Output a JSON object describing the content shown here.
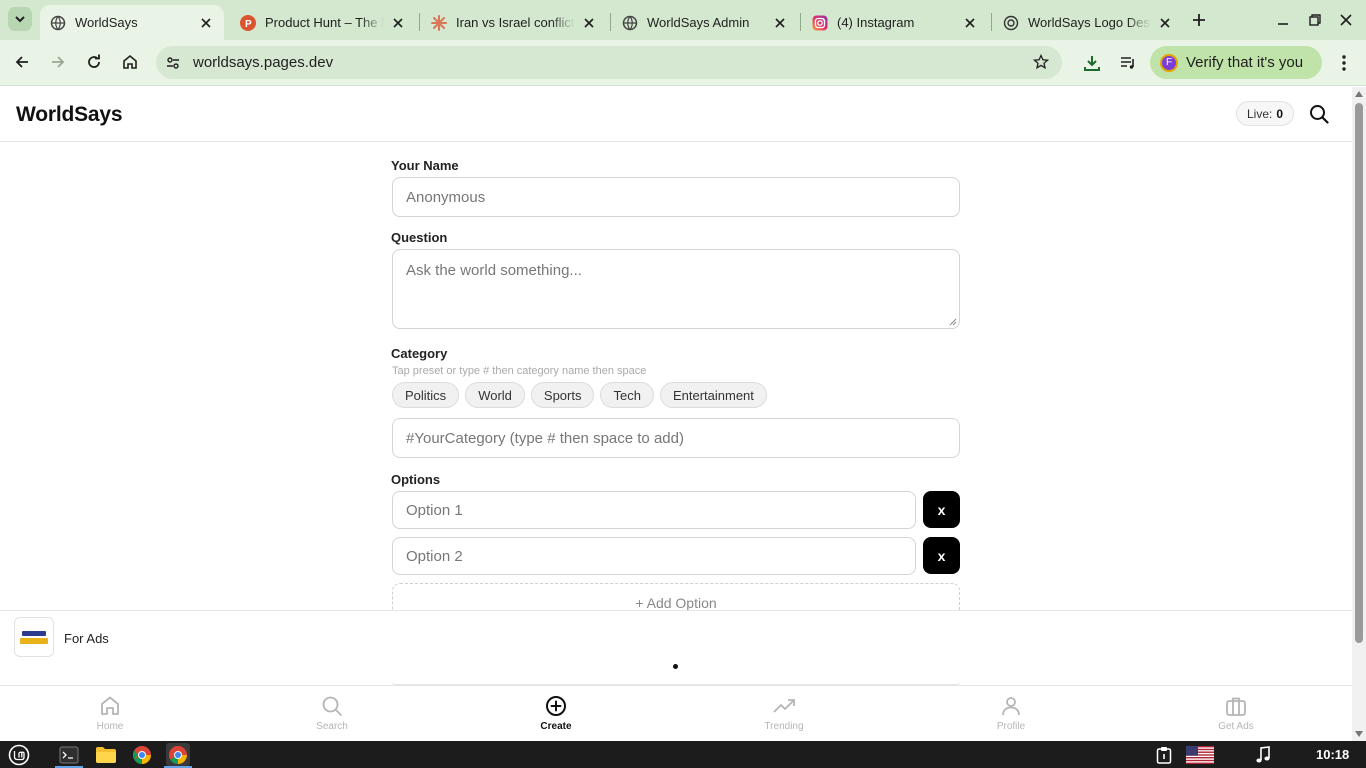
{
  "browser": {
    "tabs": [
      {
        "title": "WorldSays",
        "icon": "globe-icon",
        "active": true
      },
      {
        "title": "Product Hunt – The L",
        "icon": "product-hunt-icon",
        "active": false
      },
      {
        "title": "Iran vs Israel conflict",
        "icon": "claude-icon",
        "active": false
      },
      {
        "title": "WorldSays Admin",
        "icon": "globe-icon",
        "active": false
      },
      {
        "title": "(4) Instagram",
        "icon": "instagram-icon",
        "active": false
      },
      {
        "title": "WorldSays Logo Des",
        "icon": "chatgpt-icon",
        "active": false
      }
    ],
    "url": "worldsays.pages.dev",
    "verify_label": "Verify that it's you",
    "profile_initial": "F",
    "colors": {
      "frame": "#d3e8cf",
      "toolbar": "#eaf4e6",
      "verify": "#bfe3a8"
    }
  },
  "header": {
    "brand": "WorldSays",
    "live_label": "Live:",
    "live_count": "0"
  },
  "form": {
    "name_label": "Your Name",
    "name_placeholder": "Anonymous",
    "question_label": "Question",
    "question_placeholder": "Ask the world something...",
    "category_label": "Category",
    "category_hint": "Tap preset or type # then category name then space",
    "category_chips": [
      "Politics",
      "World",
      "Sports",
      "Tech",
      "Entertainment"
    ],
    "category_placeholder": "#YourCategory (type # then space to add)",
    "options_label": "Options",
    "options": [
      {
        "placeholder": "Option 1",
        "remove_label": "x"
      },
      {
        "placeholder": "Option 2",
        "remove_label": "x"
      }
    ],
    "add_option_label": "+ Add Option"
  },
  "ad": {
    "label": "For Ads"
  },
  "bottom_nav": {
    "items": [
      {
        "label": "Home",
        "icon": "home-icon",
        "active": false
      },
      {
        "label": "Search",
        "icon": "search-icon",
        "active": false
      },
      {
        "label": "Create",
        "icon": "plus-circle-icon",
        "active": true
      },
      {
        "label": "Trending",
        "icon": "trending-icon",
        "active": false
      },
      {
        "label": "Profile",
        "icon": "user-icon",
        "active": false
      },
      {
        "label": "Get Ads",
        "icon": "briefcase-icon",
        "active": false
      }
    ]
  },
  "taskbar": {
    "clock": "10:18"
  }
}
